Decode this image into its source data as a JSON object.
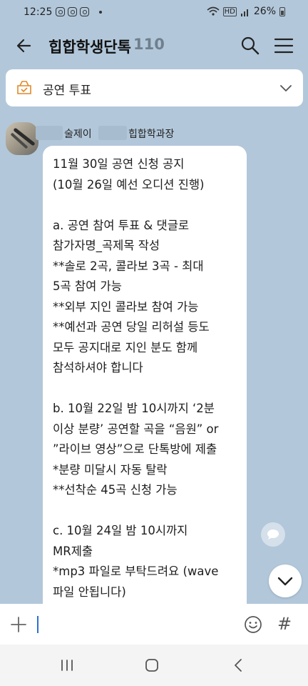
{
  "status_bar": {
    "time": "12:25",
    "signal_label": "HD",
    "battery": "26%"
  },
  "header": {
    "title": "힙합학생단톡",
    "member_count": "110"
  },
  "notice": {
    "label": "공연 투표"
  },
  "message": {
    "sender_part1": "술제이",
    "sender_part2": "힙합학과장",
    "lines": [
      "11월 30일 공연 신청 공지",
      "(10월 26일 예선 오디션 진행)",
      "",
      "a. 공연 참여 투표 & 댓글로",
      "참가자명_곡제목 작성",
      "**솔로 2곡, 콜라보 3곡 - 최대",
      "5곡 참여 가능",
      "**외부 지인 콜라보 참여 가능",
      "**예선과 공연 당일 리허설 등도",
      "모두 공지대로 지인 분도 함께",
      "참석하셔야 합니다",
      "",
      "b. 10월 22일 밤 10시까지 ‘2분",
      "이상 분량’ 공연할 곡을 “음원” or",
      "”라이브 영상”으로 단톡방에 제출",
      "*분량 미달시 자동 탈락",
      "**선착순 45곡 신청 가능",
      "",
      "c. 10월 24일 밤 10시까지",
      "MR제출",
      "*mp3 파일로 부탁드려요 (wave",
      "파일 안됩니다)"
    ]
  },
  "input": {
    "value": ""
  },
  "colors": {
    "chat_background": "#b2c7da",
    "bubble": "#ffffff",
    "cursor": "#2a6fd6",
    "count_text": "#6f7f8e"
  },
  "icons": [
    "back-arrow-icon",
    "search-icon",
    "menu-icon",
    "vote-box-icon",
    "chevron-down-icon",
    "chat-bubble-icon",
    "plus-icon",
    "emoji-icon",
    "hash-icon",
    "recents-icon",
    "home-icon",
    "nav-back-icon"
  ]
}
